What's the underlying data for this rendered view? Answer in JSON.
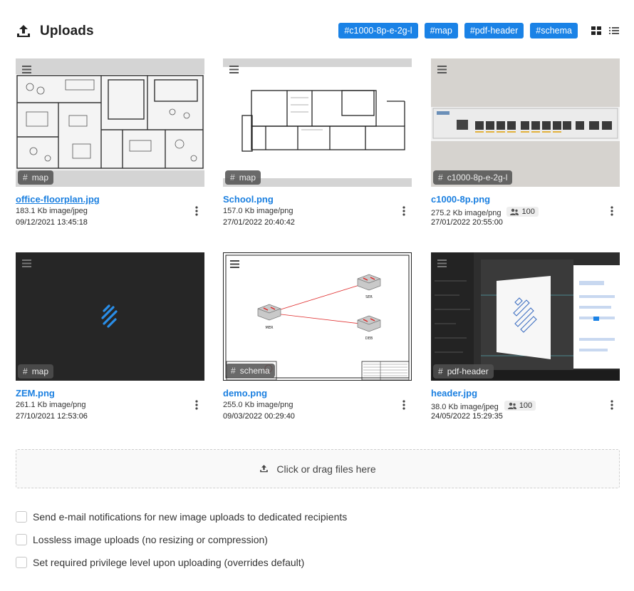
{
  "header": {
    "title": "Uploads",
    "tags": [
      "#c1000-8p-e-2g-l",
      "#map",
      "#pdf-header",
      "#schema"
    ]
  },
  "colors": {
    "accent": "#1a82e6",
    "link": "#1a7fe0",
    "chip_bg": "#505050"
  },
  "icons": {
    "upload": "upload-icon",
    "grid": "grid-view-icon",
    "list": "list-view-icon",
    "menu": "hamburger-icon",
    "more": "kebab-icon",
    "users": "users-icon"
  },
  "cards": [
    {
      "name": "office-floorplan.jpg",
      "size": "183.1 Kb",
      "type": "image/jpeg",
      "date": "09/12/2021 13:45:18",
      "tag": "map",
      "users": ""
    },
    {
      "name": "School.png",
      "size": "157.0 Kb",
      "type": "image/png",
      "date": "27/01/2022 20:40:42",
      "tag": "map",
      "users": ""
    },
    {
      "name": "c1000-8p.png",
      "size": "275.2 Kb",
      "type": "image/png",
      "date": "27/01/2022 20:55:00",
      "tag": "c1000-8p-e-2g-l",
      "users": "100"
    },
    {
      "name": "ZEM.png",
      "size": "261.1 Kb",
      "type": "image/png",
      "date": "27/10/2021 12:53:06",
      "tag": "map",
      "users": ""
    },
    {
      "name": "demo.png",
      "size": "255.0 Kb",
      "type": "image/png",
      "date": "09/03/2022 00:29:40",
      "tag": "schema",
      "users": ""
    },
    {
      "name": "header.jpg",
      "size": "38.0 Kb",
      "type": "image/jpeg",
      "date": "24/05/2022 15:29:35",
      "tag": "pdf-header",
      "users": "100"
    }
  ],
  "diagram_labels": {
    "mer": "MER",
    "ser": "SER",
    "deb": "DEB"
  },
  "dropzone": {
    "label": "Click or drag files here"
  },
  "options": [
    {
      "label": "Send e-mail notifications for new image uploads to dedicated recipients",
      "checked": false
    },
    {
      "label": "Lossless image uploads (no resizing or compression)",
      "checked": false
    },
    {
      "label": "Set required privilege level upon uploading (overrides default)",
      "checked": false
    }
  ]
}
